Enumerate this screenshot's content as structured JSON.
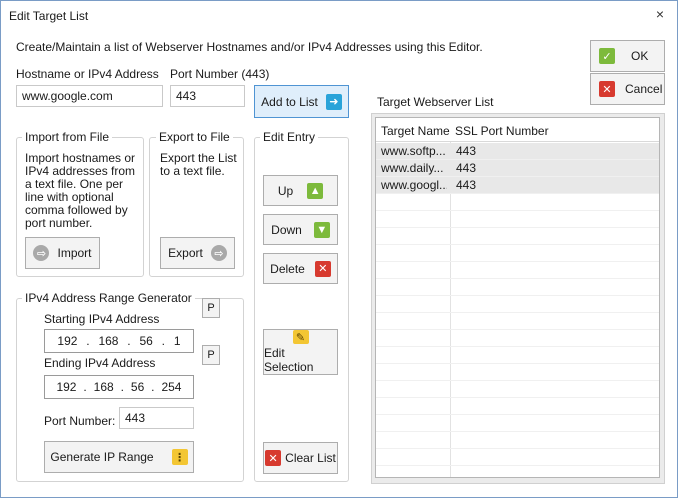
{
  "window": {
    "title": "Edit Target List",
    "close_label": "×"
  },
  "description": "Create/Maintain a list of Webserver Hostnames and/or IPv4 Addresses using this Editor.",
  "hostname": {
    "label": "Hostname or IPv4 Address",
    "value": "www.google.com"
  },
  "port": {
    "label": "Port Number (443)",
    "value": "443"
  },
  "add_to_list": {
    "label": "Add to List",
    "icon": "arrow-right-icon"
  },
  "ok_button": {
    "label": "OK",
    "icon": "check-icon"
  },
  "cancel_button": {
    "label": "Cancel",
    "icon": "x-icon"
  },
  "import_group": {
    "title": "Import from File",
    "text": "Import hostnames or IPv4 addresses from a text file. One per line with optional comma followed by port number.",
    "button_label": "Import"
  },
  "export_group": {
    "title": "Export to File",
    "text": "Export the List to a text file.",
    "button_label": "Export"
  },
  "edit_entry": {
    "title": "Edit Entry",
    "up_label": "Up",
    "down_label": "Down",
    "delete_label": "Delete",
    "edit_selection_label": "Edit Selection",
    "clear_list_label": "Clear List"
  },
  "ipv4_range": {
    "title": "IPv4 Address Range Generator",
    "p_label": "P",
    "starting_label": "Starting IPv4 Address",
    "starting_octets": [
      "192",
      "168",
      "56",
      "1"
    ],
    "ending_label": "Ending IPv4 Address",
    "ending_octets": [
      "192",
      "168",
      "56",
      "254"
    ],
    "dot": ".",
    "port_label": "Port Number:",
    "port_value": "443",
    "generate_label": "Generate IP Range"
  },
  "target_list": {
    "title": "Target Webserver List",
    "columns": [
      "Target Name",
      "SSL Port Number"
    ],
    "rows": [
      {
        "name": "www.softp...",
        "port": "443"
      },
      {
        "name": "www.daily...",
        "port": "443"
      },
      {
        "name": "www.googl...",
        "port": "443"
      }
    ]
  },
  "colors": {
    "accent": "#4f94d3",
    "ok_green": "#7dba3c",
    "cancel_red": "#d73a2f",
    "yellow": "#f3c633"
  }
}
